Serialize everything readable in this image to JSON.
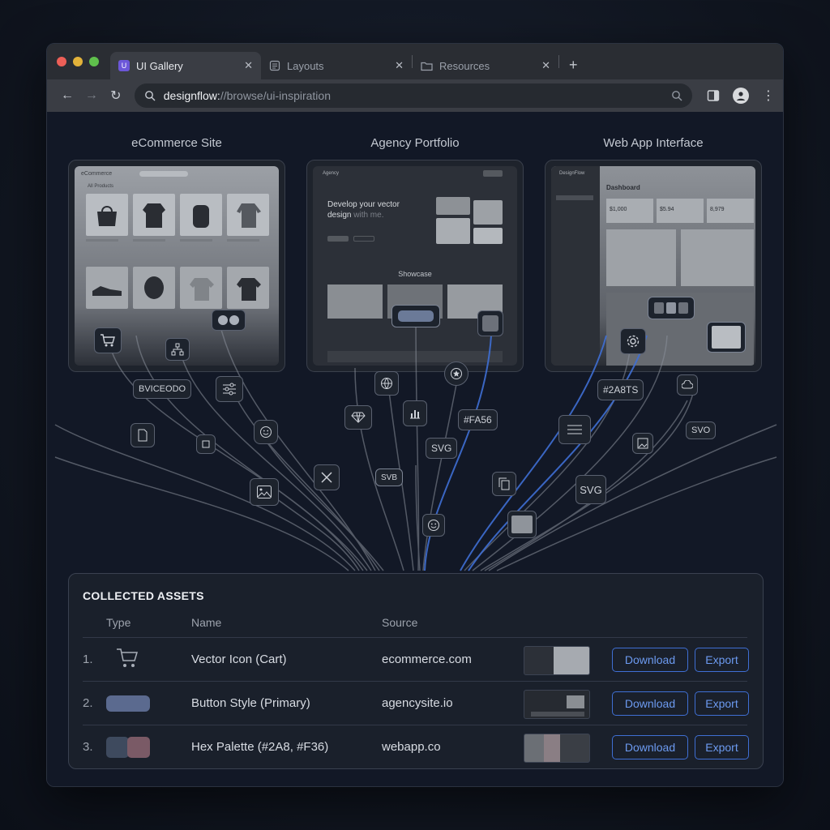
{
  "browser": {
    "tabs": [
      {
        "label": "UI Gallery",
        "icon": "ui-gallery-favicon"
      },
      {
        "label": "Layouts",
        "icon": "document-icon"
      },
      {
        "label": "Resources",
        "icon": "folder-icon"
      }
    ],
    "url_host": "designflow:",
    "url_path": "//browse/ui-inspiration"
  },
  "cards": [
    {
      "title": "eCommerce Site"
    },
    {
      "title": "Agency Portfolio"
    },
    {
      "title": "Web App Interface"
    }
  ],
  "ecommerce_preview": {
    "brand": "eCommerce",
    "section": "All Products"
  },
  "agency_preview": {
    "brand": "Agency",
    "hero_line1": "Develop your vector",
    "hero_line2": "design",
    "hero_line2b": "with me.",
    "showcase": "Showcase"
  },
  "webapp_preview": {
    "brand": "DesignFlow",
    "heading": "Dashboard",
    "stat1": "$1,000",
    "stat2": "$5.94",
    "stat3": "8,979"
  },
  "chips": {
    "hex1": "#FA56",
    "hex2": "#2A8TS",
    "code": "BVICEODO",
    "svg1": "SVG",
    "svg2": "SVG",
    "svg3": "SVB",
    "svg4": "SVO"
  },
  "assets": {
    "title": "COLLECTED ASSETS",
    "headers": {
      "type": "Type",
      "name": "Name",
      "source": "Source"
    },
    "rows": [
      {
        "num": "1.",
        "name": "Vector Icon (Cart)",
        "source": "ecommerce.com",
        "download": "Download",
        "export": "Export"
      },
      {
        "num": "2.",
        "name": "Button Style (Primary)",
        "source": "agencysite.io",
        "download": "Download",
        "export": "Export"
      },
      {
        "num": "3.",
        "name": "Hex Palette (#2A8, #F36)",
        "source": "webapp.co",
        "download": "Download",
        "export": "Export"
      }
    ]
  },
  "colors": {
    "accent_blue": "#3f6fd4",
    "swatch_primary": "#5b6a8f",
    "swatch_a": "#3e4a5e",
    "swatch_b": "#7a5a66"
  }
}
